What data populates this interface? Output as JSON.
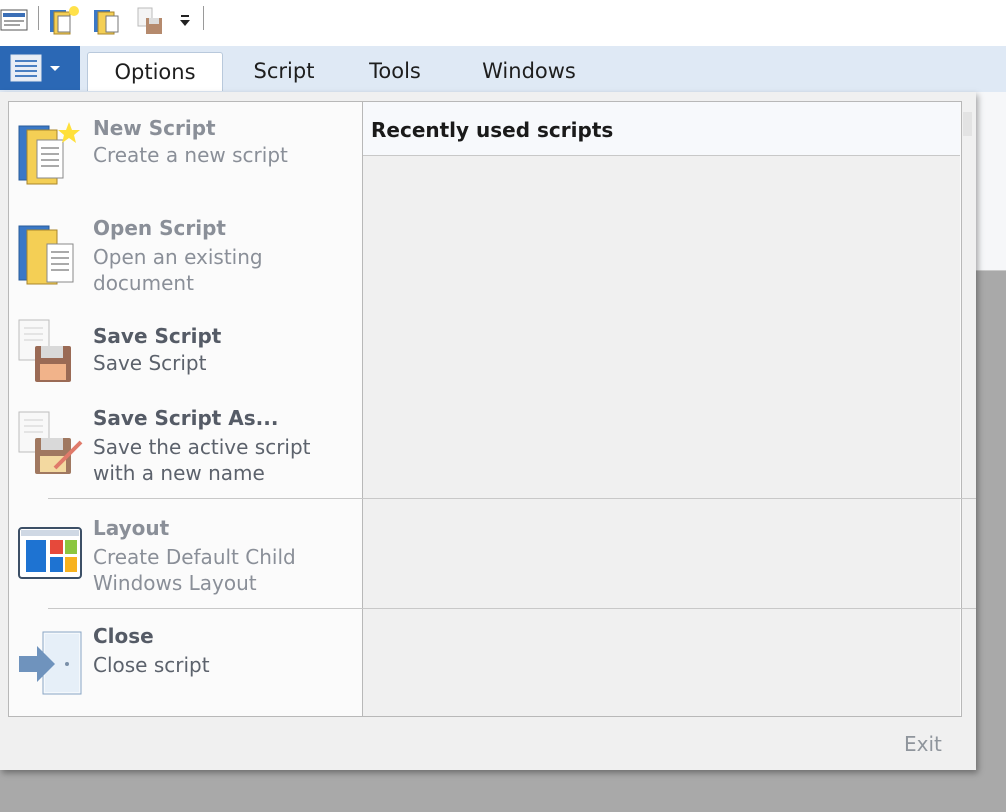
{
  "quick_access": {
    "items": [
      "properties-icon",
      "new-script-icon",
      "open-script-icon",
      "save-script-icon",
      "customize-arrow-icon"
    ]
  },
  "ribbon": {
    "app_button_icon": "app-menu-icon",
    "tabs": [
      {
        "label": "Options"
      },
      {
        "label": "Script"
      },
      {
        "label": "Tools"
      },
      {
        "label": "Windows"
      }
    ]
  },
  "app_menu": {
    "items": [
      {
        "title": "New Script",
        "description": "Create a new script",
        "icon": "new-script-icon",
        "enabled": false
      },
      {
        "title": "Open Script",
        "description": "Open an existing\ndocument",
        "icon": "open-script-icon",
        "enabled": false
      },
      {
        "title": "Save Script",
        "description": "Save Script",
        "icon": "save-script-icon",
        "enabled": true
      },
      {
        "title": "Save Script As...",
        "description": "Save the active script\nwith a new name",
        "icon": "save-as-icon",
        "enabled": true
      },
      {
        "title": "Layout",
        "description": "Create Default Child\nWindows Layout",
        "icon": "layout-icon",
        "enabled": false
      },
      {
        "title": "Close",
        "description": "Close script",
        "icon": "close-script-icon",
        "enabled": true
      }
    ],
    "recent_title": "Recently used scripts",
    "exit_label": "Exit"
  },
  "colors": {
    "app_button": "#2b68b5",
    "tab_bar": "#dfe9f5",
    "menu_bg": "#f0f0f0"
  }
}
